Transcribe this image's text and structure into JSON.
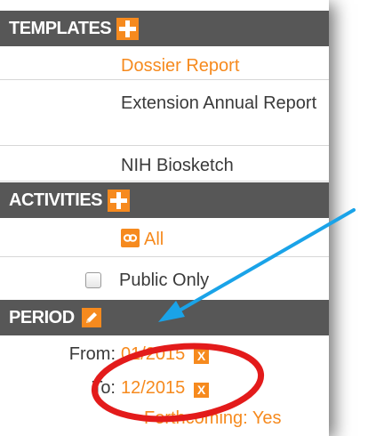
{
  "templates": {
    "header": "TEMPLATES",
    "items": [
      "Dossier Report",
      "Extension Annual Report",
      "NIH Biosketch"
    ],
    "add_icon": "plus-icon"
  },
  "activities": {
    "header": "ACTIVITIES",
    "all_label": "All",
    "all_icon": "infinity-icon",
    "public_only_label": "Public Only",
    "public_only_checked": false,
    "add_icon": "plus-icon"
  },
  "period": {
    "header": "PERIOD",
    "edit_icon": "pencil-icon",
    "from_label": "From:",
    "from_value": "01/2015",
    "to_label": "To:",
    "to_value": "12/2015",
    "forthcoming": "Forthcoming: Yes",
    "clear_glyph": "X"
  },
  "colors": {
    "header_bg": "#575757",
    "accent": "#f68a1e",
    "arrow": "#1aa3e8",
    "circle": "#e31b1b"
  }
}
